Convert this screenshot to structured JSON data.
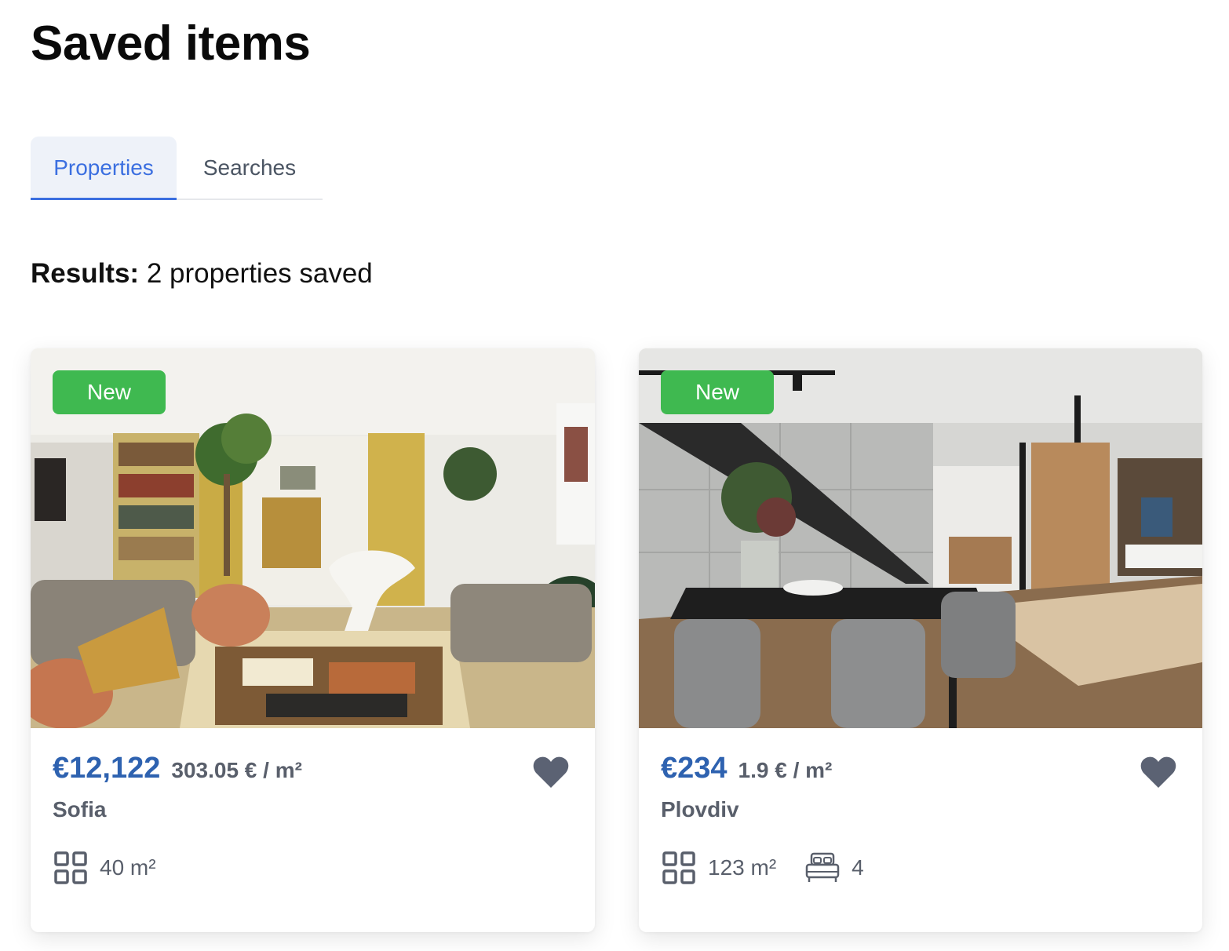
{
  "page": {
    "title": "Saved items"
  },
  "tabs": [
    {
      "label": "Properties",
      "active": true
    },
    {
      "label": "Searches",
      "active": false
    }
  ],
  "results": {
    "label": "Results:",
    "text": "2 properties saved"
  },
  "colors": {
    "accent": "#3b6fe0",
    "price": "#2e62b0",
    "badge": "#3fb950",
    "muted": "#595f6b",
    "heart": "#5b6273"
  },
  "listings": [
    {
      "badge": "New",
      "price": "€12,122",
      "price_per_m2": "303.05 € / m²",
      "city": "Sofia",
      "area": "40 m²",
      "area_icon": "grid-icon",
      "favorite_icon": "heart-icon",
      "photo": "living-room-photo"
    },
    {
      "badge": "New",
      "price": "€234",
      "price_per_m2": "1.9 € / m²",
      "city": "Plovdiv",
      "area": "123 m²",
      "area_icon": "grid-icon",
      "bedrooms": "4",
      "bedrooms_icon": "bed-icon",
      "favorite_icon": "heart-icon",
      "photo": "dining-room-photo"
    }
  ]
}
